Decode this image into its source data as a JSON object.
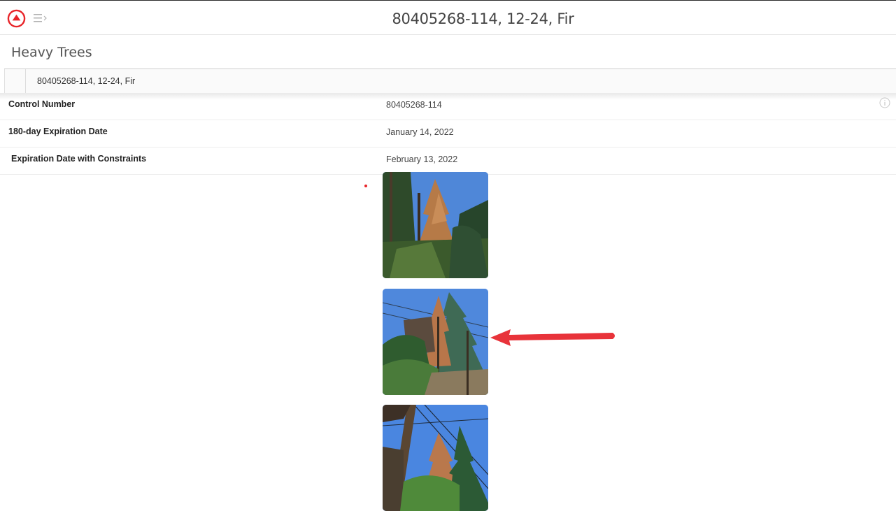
{
  "header": {
    "title": "80405268-114, 12-24, Fir",
    "app_icon": "up-arrow-circle-icon",
    "menu_icon": "menu-expand-icon",
    "accent_color": "#e8252a"
  },
  "section": {
    "title": "Heavy Trees"
  },
  "breadcrumb": {
    "label": "80405268-114, 12-24, Fir"
  },
  "details": [
    {
      "label": "Control Number",
      "value": "80405268-114",
      "icon": "info-icon"
    },
    {
      "label": "180-day Expiration Date",
      "value": "January 14, 2022"
    },
    {
      "label": "Expiration Date with Constraints",
      "value": "February 13, 2022"
    }
  ],
  "photos": [
    {
      "subject": "fir-tree-photo"
    },
    {
      "subject": "fir-tree-photo"
    },
    {
      "subject": "fir-tree-photo"
    }
  ],
  "annotation": {
    "color": "#e8333a",
    "icon": "red-arrow-pointing-left"
  }
}
